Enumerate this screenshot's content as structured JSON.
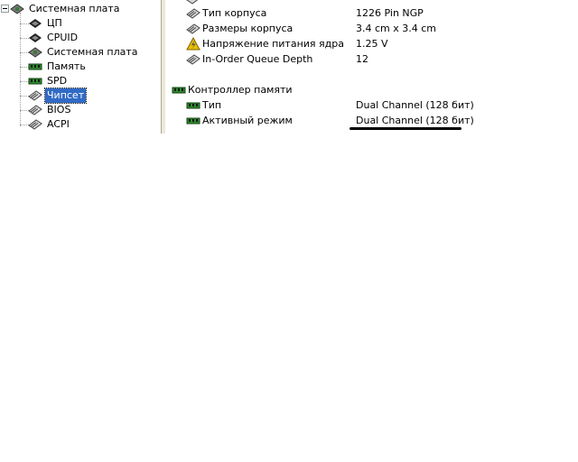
{
  "tree": {
    "items": [
      {
        "label": "Системная плата",
        "icon": "motherboard-icon"
      },
      {
        "label": "ЦП",
        "icon": "cpu-chip-icon"
      },
      {
        "label": "CPUID",
        "icon": "cpu-chip-icon"
      },
      {
        "label": "Системная плата",
        "icon": "motherboard-icon"
      },
      {
        "label": "Память",
        "icon": "memory-module-icon"
      },
      {
        "label": "SPD",
        "icon": "memory-module-icon"
      },
      {
        "label": "Чипсет",
        "icon": "chip-icon"
      },
      {
        "label": "BIOS",
        "icon": "chip-icon"
      },
      {
        "label": "ACPI",
        "icon": "chip-icon"
      }
    ],
    "selected": "Чипсет"
  },
  "details": {
    "cpu_rows": [
      {
        "field": "Тип корпуса",
        "value": "1226 Pin NGP",
        "icon": "chip-icon"
      },
      {
        "field": "Размеры корпуса",
        "value": "3.4 cm x 3.4 cm",
        "icon": "chip-icon"
      },
      {
        "field": "Напряжение питания ядра",
        "value": "1.25 V",
        "icon": "voltage-warning-icon"
      },
      {
        "field": "In-Order Queue Depth",
        "value": "12",
        "icon": "chip-icon"
      }
    ],
    "memory_section": {
      "title": "Контроллер памяти",
      "icon": "memory-module-icon",
      "rows": [
        {
          "field": "Тип",
          "value": "Dual Channel  (128 бит)",
          "icon": "memory-module-icon"
        },
        {
          "field": "Активный режим",
          "value": "Dual Channel  (128 бит)",
          "icon": "memory-module-icon"
        }
      ]
    }
  },
  "colors": {
    "selection": "#316ac5",
    "splitter": "#ece9d8",
    "memory_icon": "#2e8b2e",
    "chip_icon": "#5a5a5a",
    "warning_icon": "#e8c000"
  }
}
